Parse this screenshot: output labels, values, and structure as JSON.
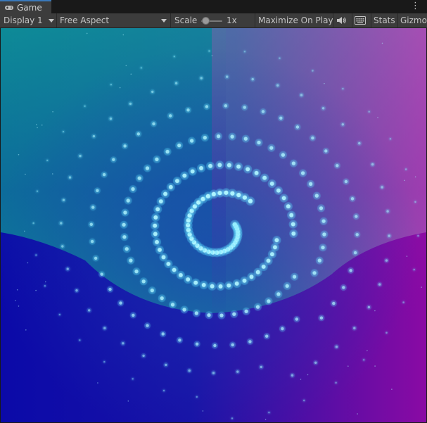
{
  "tab": {
    "title": "Game",
    "icon": "gamepad-icon"
  },
  "window_menu_icon": "⋮",
  "toolbar": {
    "display": "Display 1",
    "aspect": "Free Aspect",
    "scale_label": "Scale",
    "scale_value": "1x",
    "scale_level": 0.1,
    "maximize": "Maximize On Play",
    "audio_icon": "speaker-icon",
    "keyboard_icon": "keyboard-icon",
    "stats": "Stats",
    "gizmos": "Gizmos"
  },
  "scene": {
    "background_colors": [
      "#0b0aa8",
      "#0d8f96",
      "#8c1aa8",
      "#b04fb0"
    ],
    "dot_color": "#aef4ff",
    "glow_color": "#3fd8ff"
  }
}
